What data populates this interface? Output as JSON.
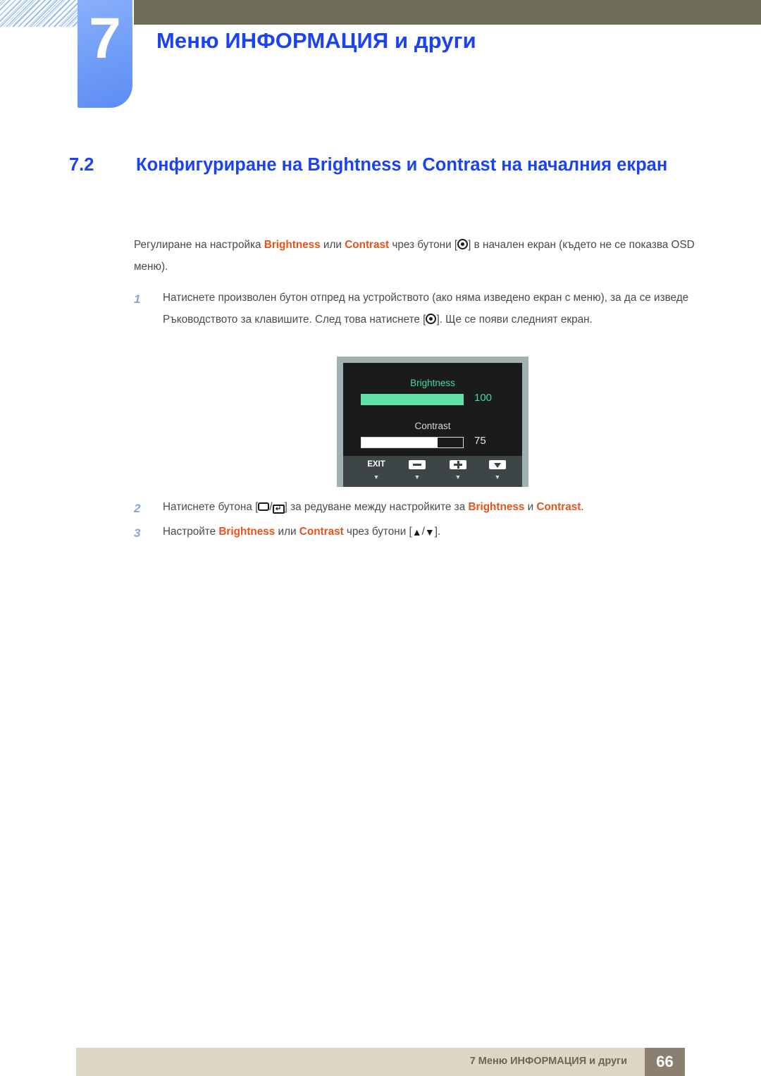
{
  "header": {
    "chapter_number": "7",
    "chapter_title": "Меню ИНФОРМАЦИЯ и други"
  },
  "section": {
    "number": "7.2",
    "title": "Конфигуриране на Brightness и Contrast на началния екран"
  },
  "intro": {
    "part1": "Регулиране на настройка ",
    "kw1": "Brightness",
    "part2": " или ",
    "kw2": "Contrast",
    "part3": " чрез бутони [",
    "part4": "] в начален екран (където не се показва OSD меню)."
  },
  "steps": {
    "step1": {
      "number": "1",
      "part1": "Натиснете произволен бутон отпред на устройството (ако няма изведено екран с меню), за да се изведе Ръководството за клавишите. След това натиснете [",
      "part2": "]. Ще се появи следният екран."
    },
    "step2": {
      "number": "2",
      "part1": "Натиснете бутона [",
      "sep": "/",
      "part2": "] за редуване между настройките за ",
      "kw1": "Brightness",
      "part3": " и ",
      "kw2": "Contrast",
      "part4": "."
    },
    "step3": {
      "number": "3",
      "part1": "Настройте ",
      "kw1": "Brightness",
      "part2": " или ",
      "kw2": "Contrast",
      "part3": " чрез бутони [",
      "up": "▲",
      "sep": "/",
      "down": "▼",
      "part4": "]."
    }
  },
  "osd": {
    "brightness_label": "Brightness",
    "brightness_value": "100",
    "brightness_percent": 100,
    "contrast_label": "Contrast",
    "contrast_value": "75",
    "contrast_percent": 75,
    "buttons": {
      "exit": "EXIT",
      "minus": "minus-button",
      "plus": "plus-button",
      "down": "down-button"
    },
    "caret": "▼",
    "colors": {
      "accent_green": "#49d99b",
      "bar_green": "#5fe3a8",
      "screen_bg": "#1b1b1b",
      "bezel": "#9fb1b1",
      "footer_bg": "#3d4546"
    }
  },
  "footer": {
    "text": "7 Меню ИНФОРМАЦИЯ и други",
    "page": "66"
  },
  "theme": {
    "heading_blue": "#1b43f2",
    "tab_blue": "#6e9cf7",
    "olive": "#6e6b56",
    "keyword_orange": "#e8521b",
    "footer_beige": "#dcd7c4",
    "footer_page_brown": "#8b7f71"
  }
}
